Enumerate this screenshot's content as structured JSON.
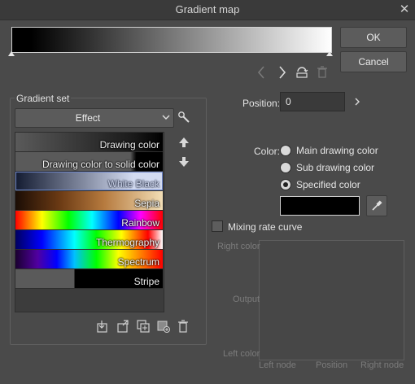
{
  "window": {
    "title": "Gradient map",
    "close_glyph": "✕"
  },
  "buttons": {
    "ok": "OK",
    "cancel": "Cancel"
  },
  "nav": {
    "prev_icon": "chevron-left-icon",
    "next_icon": "chevron-right-icon",
    "flip_icon": "flip-icon",
    "delete_icon": "trash-icon"
  },
  "gradient_set": {
    "title": "Gradient set",
    "selected_set": "Effect",
    "items": [
      {
        "label": "Drawing color"
      },
      {
        "label": "Drawing color to solid color"
      },
      {
        "label": "White Black"
      },
      {
        "label": "Sepia"
      },
      {
        "label": "Rainbow"
      },
      {
        "label": "Thermography"
      },
      {
        "label": "Spectrum"
      },
      {
        "label": "Stripe"
      }
    ],
    "selected_index": 2
  },
  "position": {
    "label": "Position:",
    "value": "0"
  },
  "color": {
    "label": "Color:",
    "options": [
      "Main drawing color",
      "Sub drawing color",
      "Specified color"
    ],
    "selected": "Specified color",
    "swatch": "#000000"
  },
  "mixing": {
    "label": "Mixing rate curve",
    "checked": false,
    "right_color": "Right color",
    "output": "Output",
    "left_color": "Left color",
    "left_node": "Left node",
    "position": "Position",
    "right_node": "Right node"
  },
  "colors": {
    "bg": "#4a4a4a",
    "accent_selected": "#6c84c8"
  }
}
